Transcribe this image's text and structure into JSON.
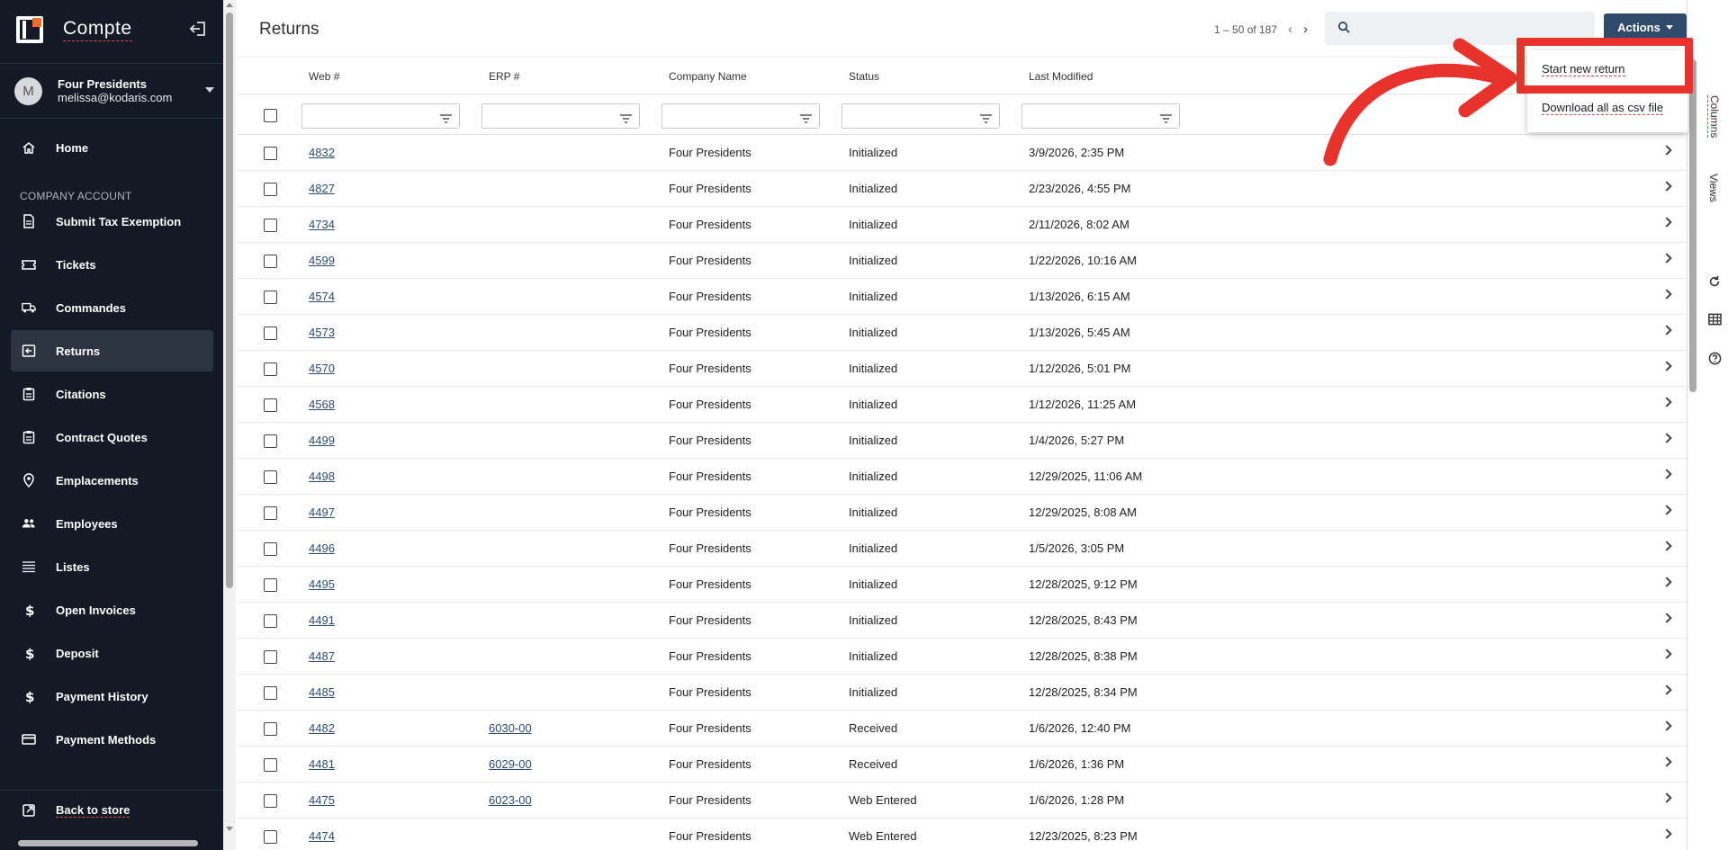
{
  "brand": {
    "title": "Compte"
  },
  "user": {
    "initial": "M",
    "name": "Four Presidents",
    "email": "melissa@kodaris.com"
  },
  "nav": {
    "home": "Home",
    "section_label": "COMPANY ACCOUNT",
    "items": [
      {
        "label": "Submit Tax Exemption",
        "icon": "document-icon"
      },
      {
        "label": "Tickets",
        "icon": "ticket-icon"
      },
      {
        "label": "Commandes",
        "icon": "truck-icon"
      },
      {
        "label": "Returns",
        "icon": "return-icon",
        "active": true
      },
      {
        "label": "Citations",
        "icon": "clipboard-icon"
      },
      {
        "label": "Contract Quotes",
        "icon": "clipboard-icon"
      },
      {
        "label": "Emplacements",
        "icon": "location-pin-icon"
      },
      {
        "label": "Employees",
        "icon": "people-icon"
      },
      {
        "label": "Listes",
        "icon": "list-icon"
      },
      {
        "label": "Open Invoices",
        "icon": "dollar-icon"
      },
      {
        "label": "Deposit",
        "icon": "dollar-icon"
      },
      {
        "label": "Payment History",
        "icon": "dollar-icon"
      },
      {
        "label": "Payment Methods",
        "icon": "credit-card-icon"
      }
    ],
    "back_to_store": "Back to store"
  },
  "page": {
    "title": "Returns",
    "pager": "1 – 50 of 187",
    "actions_label": "Actions"
  },
  "table": {
    "headers": {
      "web": "Web #",
      "erp": "ERP #",
      "company": "Company Name",
      "status": "Status",
      "modified": "Last Modified"
    },
    "rows": [
      {
        "web": "4832",
        "erp": "",
        "company": "Four Presidents",
        "status": "Initialized",
        "modified": "3/9/2026, 2:35 PM"
      },
      {
        "web": "4827",
        "erp": "",
        "company": "Four Presidents",
        "status": "Initialized",
        "modified": "2/23/2026, 4:55 PM"
      },
      {
        "web": "4734",
        "erp": "",
        "company": "Four Presidents",
        "status": "Initialized",
        "modified": "2/11/2026, 8:02 AM"
      },
      {
        "web": "4599",
        "erp": "",
        "company": "Four Presidents",
        "status": "Initialized",
        "modified": "1/22/2026, 10:16 AM"
      },
      {
        "web": "4574",
        "erp": "",
        "company": "Four Presidents",
        "status": "Initialized",
        "modified": "1/13/2026, 6:15 AM"
      },
      {
        "web": "4573",
        "erp": "",
        "company": "Four Presidents",
        "status": "Initialized",
        "modified": "1/13/2026, 5:45 AM"
      },
      {
        "web": "4570",
        "erp": "",
        "company": "Four Presidents",
        "status": "Initialized",
        "modified": "1/12/2026, 5:01 PM"
      },
      {
        "web": "4568",
        "erp": "",
        "company": "Four Presidents",
        "status": "Initialized",
        "modified": "1/12/2026, 11:25 AM"
      },
      {
        "web": "4499",
        "erp": "",
        "company": "Four Presidents",
        "status": "Initialized",
        "modified": "1/4/2026, 5:27 PM"
      },
      {
        "web": "4498",
        "erp": "",
        "company": "Four Presidents",
        "status": "Initialized",
        "modified": "12/29/2025, 11:06 AM"
      },
      {
        "web": "4497",
        "erp": "",
        "company": "Four Presidents",
        "status": "Initialized",
        "modified": "12/29/2025, 8:08 AM"
      },
      {
        "web": "4496",
        "erp": "",
        "company": "Four Presidents",
        "status": "Initialized",
        "modified": "1/5/2026, 3:05 PM"
      },
      {
        "web": "4495",
        "erp": "",
        "company": "Four Presidents",
        "status": "Initialized",
        "modified": "12/28/2025, 9:12 PM"
      },
      {
        "web": "4491",
        "erp": "",
        "company": "Four Presidents",
        "status": "Initialized",
        "modified": "12/28/2025, 8:43 PM"
      },
      {
        "web": "4487",
        "erp": "",
        "company": "Four Presidents",
        "status": "Initialized",
        "modified": "12/28/2025, 8:38 PM"
      },
      {
        "web": "4485",
        "erp": "",
        "company": "Four Presidents",
        "status": "Initialized",
        "modified": "12/28/2025, 8:34 PM"
      },
      {
        "web": "4482",
        "erp": "6030-00",
        "company": "Four Presidents",
        "status": "Received",
        "modified": "1/6/2026, 12:40 PM"
      },
      {
        "web": "4481",
        "erp": "6029-00",
        "company": "Four Presidents",
        "status": "Received",
        "modified": "1/6/2026, 1:36 PM"
      },
      {
        "web": "4475",
        "erp": "6023-00",
        "company": "Four Presidents",
        "status": "Web Entered",
        "modified": "1/6/2026, 1:28 PM"
      },
      {
        "web": "4474",
        "erp": "",
        "company": "Four Presidents",
        "status": "Web Entered",
        "modified": "12/23/2025, 8:23 PM"
      }
    ]
  },
  "side_panel": {
    "columns": "Columns",
    "views": "Views"
  },
  "dropdown": {
    "start_new": "Start new return",
    "download_csv": "Download all as csv file"
  },
  "colors": {
    "sidebar_bg": "#131a26",
    "accent_button": "#2f4a6b",
    "annotation_red": "#e8322c",
    "brand_orange": "#e8702a"
  }
}
